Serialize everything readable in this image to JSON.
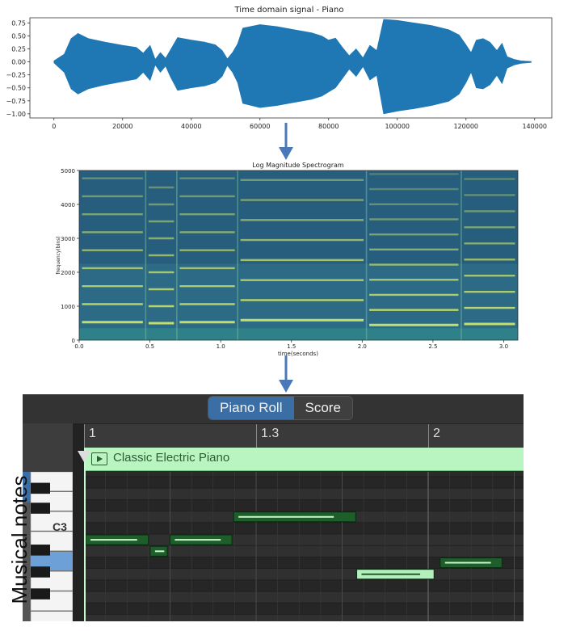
{
  "chart_data": [
    {
      "type": "line",
      "title": "Time domain signal - Piano",
      "xlabel": "",
      "ylabel": "",
      "xlim": [
        -7000,
        145000
      ],
      "ylim": [
        -1.08,
        0.85
      ],
      "xticks": [
        0,
        20000,
        40000,
        60000,
        80000,
        100000,
        120000,
        140000
      ],
      "xtick_labels": [
        "0",
        "20000",
        "40000",
        "60000",
        "80000",
        "100000",
        "120000",
        "140000"
      ],
      "yticks": [
        0.75,
        0.5,
        0.25,
        0.0,
        -0.25,
        -0.5,
        -0.75,
        -1.0
      ],
      "ytick_labels": [
        "0.75",
        "0.50",
        "0.25",
        "0.00",
        "−0.25",
        "−0.50",
        "−0.75",
        "−1.00"
      ],
      "color": "#1f77b4",
      "envelope": {
        "x": [
          0,
          3000,
          5000,
          7000,
          10000,
          15000,
          20000,
          24000,
          26000,
          28000,
          29500,
          31000,
          32500,
          34000,
          36000,
          40000,
          44000,
          47000,
          49000,
          50500,
          52000,
          53500,
          55000,
          60000,
          65000,
          70000,
          75000,
          78000,
          80000,
          82000,
          84000,
          86000,
          88000,
          90000,
          92000,
          94000,
          96000,
          100000,
          105000,
          110000,
          115000,
          118000,
          120000,
          121500,
          123000,
          125000,
          127000,
          129000,
          130500,
          132000,
          134000,
          136000,
          139000
        ],
        "upper": [
          0.02,
          0.15,
          0.45,
          0.55,
          0.45,
          0.38,
          0.32,
          0.28,
          0.17,
          0.32,
          0.05,
          0.18,
          0.07,
          0.24,
          0.47,
          0.42,
          0.38,
          0.33,
          0.22,
          0.06,
          0.18,
          0.35,
          0.65,
          0.72,
          0.68,
          0.62,
          0.56,
          0.5,
          0.42,
          0.46,
          0.28,
          0.12,
          0.25,
          0.08,
          0.32,
          0.22,
          0.82,
          0.8,
          0.75,
          0.7,
          0.62,
          0.52,
          0.33,
          0.18,
          0.42,
          0.45,
          0.38,
          0.22,
          0.36,
          0.1,
          0.05,
          0.02,
          0.01
        ],
        "lower": [
          -0.02,
          -0.2,
          -0.52,
          -0.62,
          -0.52,
          -0.44,
          -0.38,
          -0.33,
          -0.2,
          -0.36,
          -0.06,
          -0.2,
          -0.08,
          -0.3,
          -0.55,
          -0.5,
          -0.46,
          -0.4,
          -0.28,
          -0.07,
          -0.2,
          -0.4,
          -0.8,
          -0.88,
          -0.84,
          -0.78,
          -0.72,
          -0.66,
          -0.58,
          -0.5,
          -0.32,
          -0.14,
          -0.28,
          -0.09,
          -0.35,
          -0.26,
          -1.0,
          -0.95,
          -0.9,
          -0.84,
          -0.76,
          -0.62,
          -0.4,
          -0.2,
          -0.5,
          -0.52,
          -0.44,
          -0.26,
          -0.42,
          -0.12,
          -0.06,
          -0.03,
          -0.01
        ]
      }
    },
    {
      "type": "heatmap",
      "title": "Log Magnitude Spectrogram",
      "xlabel": "time(seconds)",
      "ylabel": "frequency(bins)",
      "xlim": [
        0.0,
        3.1
      ],
      "ylim": [
        0,
        5000
      ],
      "xticks": [
        0.0,
        0.5,
        1.0,
        1.5,
        2.0,
        2.5,
        3.0
      ],
      "xtick_labels": [
        "0.0",
        "0.5",
        "1.0",
        "1.5",
        "2.0",
        "2.5",
        "3.0"
      ],
      "yticks": [
        0,
        1000,
        2000,
        3000,
        4000,
        5000
      ],
      "ytick_labels": [
        "0",
        "1000",
        "2000",
        "3000",
        "4000",
        "5000"
      ],
      "background_color": "#2c6a86",
      "harmonic_color": "#cfe86a",
      "notes": [
        {
          "t0": 0.0,
          "t1": 0.47,
          "f0": 530
        },
        {
          "t0": 0.47,
          "t1": 0.69,
          "f0": 500
        },
        {
          "t0": 0.69,
          "t1": 1.12,
          "f0": 530
        },
        {
          "t0": 1.12,
          "t1": 2.03,
          "f0": 590
        },
        {
          "t0": 2.03,
          "t1": 2.7,
          "f0": 445
        },
        {
          "t0": 2.7,
          "t1": 3.1,
          "f0": 475
        }
      ],
      "boundaries": [
        0.47,
        0.69,
        1.12,
        2.03,
        2.7
      ]
    }
  ],
  "piano_roll": {
    "tabs": [
      "Piano Roll",
      "Score"
    ],
    "active_tab": "Piano Roll",
    "ruler_labels": [
      {
        "label": "1",
        "beat": 0
      },
      {
        "label": "1.3",
        "beat": 2
      },
      {
        "label": "2",
        "beat": 4
      }
    ],
    "region_title": "Classic Electric Piano",
    "key_label": "C3",
    "note_color": "#1e5e2a",
    "selected_note_color": "#b5f0bc",
    "notes": [
      {
        "start": 0.0,
        "length": 0.73,
        "row": 5,
        "selected": false
      },
      {
        "start": 0.75,
        "length": 0.2,
        "row": 6,
        "selected": false
      },
      {
        "start": 0.98,
        "length": 0.72,
        "row": 5,
        "selected": false
      },
      {
        "start": 1.72,
        "length": 1.42,
        "row": 3,
        "selected": false
      },
      {
        "start": 3.15,
        "length": 0.9,
        "row": 8,
        "selected": true
      },
      {
        "start": 4.12,
        "length": 0.72,
        "row": 7,
        "selected": false
      }
    ]
  },
  "side_label": "Musical notes"
}
